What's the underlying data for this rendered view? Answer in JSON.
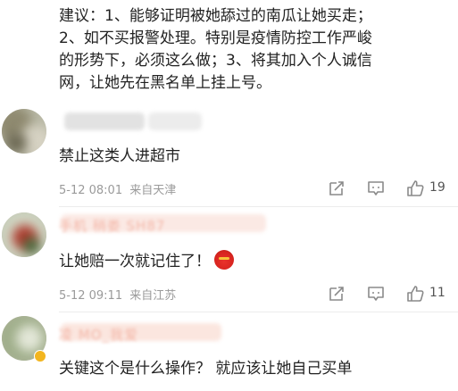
{
  "top_comment": {
    "lines": [
      "建议：1、能够证明被她舔过的南瓜让她买走；",
      "2、如不买报警处理。特别是疫情防控工作严峻",
      "的形势下，必须这么做；3、将其加入个人诚信",
      "网，让她先在黑名单上挂上号。"
    ]
  },
  "comments": [
    {
      "content": "禁止这类人进超市",
      "date": "5-12 08:01",
      "source": "来自天津",
      "likes": "19"
    },
    {
      "username": "手机   稍娄 SH87",
      "content": "让她赔一次就记住了！",
      "emoji": "angry-face-emoji",
      "date": "5-12 09:11",
      "source": "来自江苏",
      "likes": "11"
    },
    {
      "username": "    凌 MO_我爱 ",
      "content": "关键这个是什么操作？ 就应该让她自己买单"
    }
  ],
  "colors": {
    "text": "#222222",
    "meta": "#9a9a9a",
    "icon": "#8a8a8a",
    "vip_badge": "#f2b51f"
  }
}
